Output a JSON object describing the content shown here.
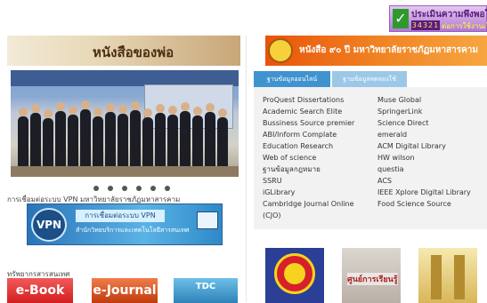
{
  "survey_badge": {
    "title": "ประเมินความพึงพอใจ",
    "counter": "34321",
    "subtitle": "ต่อการใช้งานเว็บไซต์"
  },
  "left": {
    "book_banner": "หนังสือของพ่อ",
    "slider_dots": 6,
    "vpn_section_title": "การเชื่อมต่อระบบ VPN มหาวิทยาลัยราชภัฏมหาสารคาม",
    "vpn_banner": {
      "badge": "VPN",
      "line1": "การเชื่อมต่อระบบ VPN",
      "line2": "สำนักวิทยบริการและเทคโนโลยีสารสนเทศ"
    },
    "resources_title": "ทรัพยากรสารสนเทศ",
    "resources": [
      "e-Book",
      "e-Journal",
      "TDC"
    ]
  },
  "right": {
    "announcement": "หนังสือ ๙๐ ปี มหาวิทยาลัยราชภัฏมหาสารคาม",
    "tabs": [
      "ฐานข้อมูลออนไลน์",
      "ฐานข้อมูลทดลองใช้"
    ],
    "databases_left": [
      "ProQuest Dissertations",
      "Academic Search Elite",
      "Bussiness Source premier",
      "ABI/Inform Complate",
      "Education Research",
      "Web of science",
      "ฐานข้อมูลกฎหมาย",
      "SSRU",
      "iGLibrary",
      "Cambridge Journal Online",
      "(CJO)"
    ],
    "databases_right": [
      "Muse Global",
      "SpringerLink",
      "Science Direct",
      "emerald",
      "ACM Digital Library",
      "HW wilson",
      "questia",
      "ACS",
      "IEEE Xplore Digital Library",
      "Food Science Source"
    ],
    "thumbnails": [
      "ASEAN",
      "ศูนย์การเรียนรู้",
      "ห้องสมุด"
    ]
  }
}
